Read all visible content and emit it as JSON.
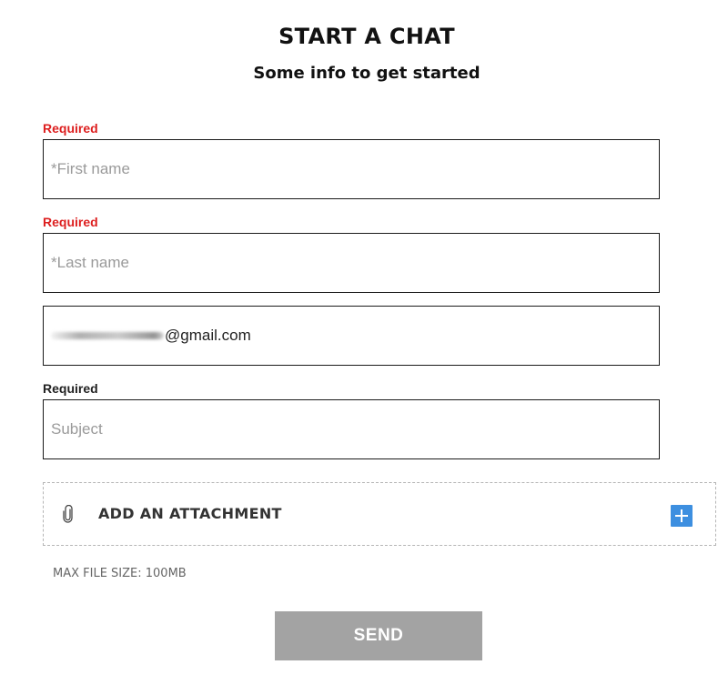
{
  "header": {
    "title": "START A CHAT",
    "subtitle": "Some info to get started"
  },
  "form": {
    "first_name": {
      "required_label": "Required",
      "placeholder": "*First name",
      "value": ""
    },
    "last_name": {
      "required_label": "Required",
      "placeholder": "*Last name",
      "value": ""
    },
    "email": {
      "value_visible": "gmail.com",
      "value_prefix": "@"
    },
    "subject": {
      "required_label": "Required",
      "placeholder": "Subject",
      "value": ""
    },
    "attachment": {
      "label": "ADD AN ATTACHMENT",
      "icon": "paperclip-icon",
      "add_icon": "plus-icon",
      "max_size": "MAX FILE SIZE: 100MB"
    },
    "send_label": "SEND"
  },
  "colors": {
    "required_red": "#dd1f1f",
    "add_button_blue": "#3d8fe0",
    "send_button_gray": "#a3a3a3"
  }
}
